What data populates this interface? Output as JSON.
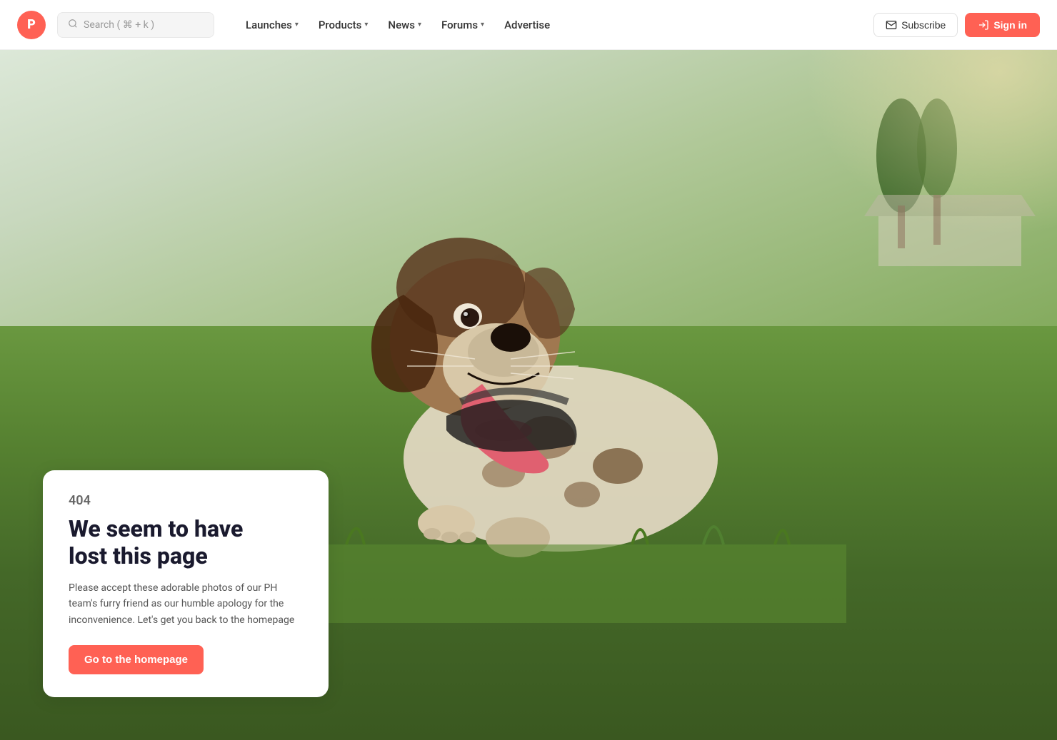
{
  "navbar": {
    "logo_letter": "P",
    "search_placeholder": "Search ( ⌘ + k )",
    "nav_items": [
      {
        "label": "Launches",
        "has_dropdown": true
      },
      {
        "label": "Products",
        "has_dropdown": true
      },
      {
        "label": "News",
        "has_dropdown": true
      },
      {
        "label": "Forums",
        "has_dropdown": true
      },
      {
        "label": "Advertise",
        "has_dropdown": false
      }
    ],
    "subscribe_label": "Subscribe",
    "signin_label": "Sign in"
  },
  "error_page": {
    "code": "404",
    "title_line1": "We seem to have",
    "title_line2": "lost this page",
    "description": "Please accept these adorable photos of our PH team's furry friend as our humble apology for the inconvenience. Let's get you back to the homepage",
    "cta_label": "Go to the homepage"
  },
  "colors": {
    "brand_red": "#ff6154",
    "text_dark": "#1a1a2e",
    "text_muted": "#555555",
    "error_code_color": "#666666"
  }
}
